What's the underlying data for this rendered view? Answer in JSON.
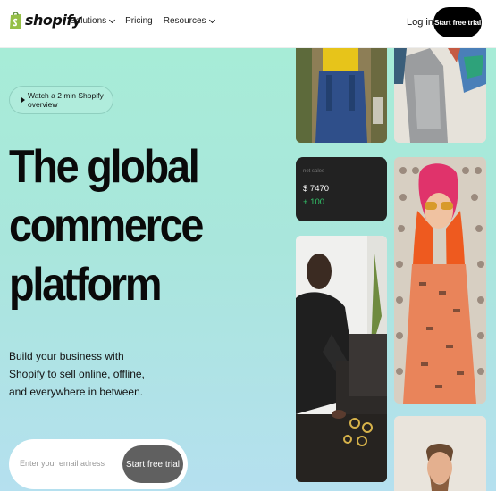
{
  "header": {
    "logo_text": "shopify",
    "nav": [
      {
        "label": "Solutions",
        "has_dropdown": true
      },
      {
        "label": "Pricing",
        "has_dropdown": false
      },
      {
        "label": "Resources",
        "has_dropdown": true
      }
    ],
    "login_label": "Log in",
    "cta_label": "Start free trial"
  },
  "hero": {
    "video_label": "Watch a 2 min Shopify overview",
    "headline": [
      "The global",
      "commerce",
      "platform"
    ],
    "subtext": "Build your business with Shopify to sell online, offline, and everywhere in between.",
    "email_placeholder": "Enter your email adress",
    "cta_label": "Start free trial"
  },
  "sales_card": {
    "label": "net sales",
    "value": "$ 7470",
    "delta": "+ 100"
  },
  "colors": {
    "brand_green": "#95bf47",
    "hero_gradient_top": "#a7ecd7",
    "hero_gradient_bottom": "#b5e0ef",
    "cta_black": "#000000",
    "delta_green": "#33c46a"
  }
}
